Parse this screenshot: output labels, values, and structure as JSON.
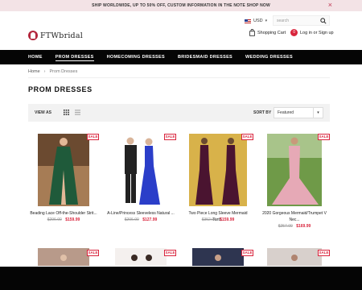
{
  "announcement": {
    "text": "SHIP WORLDWIDE, UP TO 50% OFF, CUSTOM INFORMATION IN THE NOTE SHOP NOW",
    "close": "×"
  },
  "header": {
    "currency": "USD",
    "search_placeholder": "search",
    "logo_text": "FTWbridal",
    "cart_label": "Shopping Cart",
    "cart_count": "0",
    "login_label": "Log in",
    "or_label": "or",
    "signup_label": "Sign up"
  },
  "nav": {
    "items": [
      {
        "label": "HOME"
      },
      {
        "label": "PROM DRESSES"
      },
      {
        "label": "HOMECOMING DRESSES"
      },
      {
        "label": "BRIDESMAID DRESSES"
      },
      {
        "label": "WEDDING DRESSES"
      }
    ],
    "active_index": 1
  },
  "breadcrumb": {
    "home": "Home",
    "separator": "›",
    "current": "Prom Dresses"
  },
  "page_title": "PROM DRESSES",
  "toolbar": {
    "view_as": "VIEW AS",
    "sort_by": "SORT BY",
    "sort_value": "Featured"
  },
  "products": [
    {
      "name": "Beading Lace Off-the-Shoulder Strit...",
      "old_price": "$296.00",
      "new_price": "$159.99",
      "badge": "SALE",
      "dress_color": "#1f5a3a",
      "bg_color": "#a67c55"
    },
    {
      "name": "A-Line/Princess Sleeveless Natural ...",
      "old_price": "$206.00",
      "new_price": "$127.99",
      "badge": "SALE",
      "dress_color": "#2b3ec9",
      "bg_color": "#ffffff"
    },
    {
      "name": "Two Piece Long Sleeve Mermaid Turtl...",
      "old_price": "$352.00",
      "new_price": "$159.99",
      "badge": "SALE",
      "dress_color": "#4a1430",
      "bg_color": "#d8b24a"
    },
    {
      "name": "2020 Gorgeous Mermaid/Trumpet V Nec...",
      "old_price": "$257.00",
      "new_price": "$169.99",
      "badge": "SALE",
      "dress_color": "#e6a9b6",
      "bg_color": "#6f9a48"
    }
  ],
  "row2_badges": [
    "SALE",
    "SALE",
    "SALE",
    "SALE"
  ]
}
